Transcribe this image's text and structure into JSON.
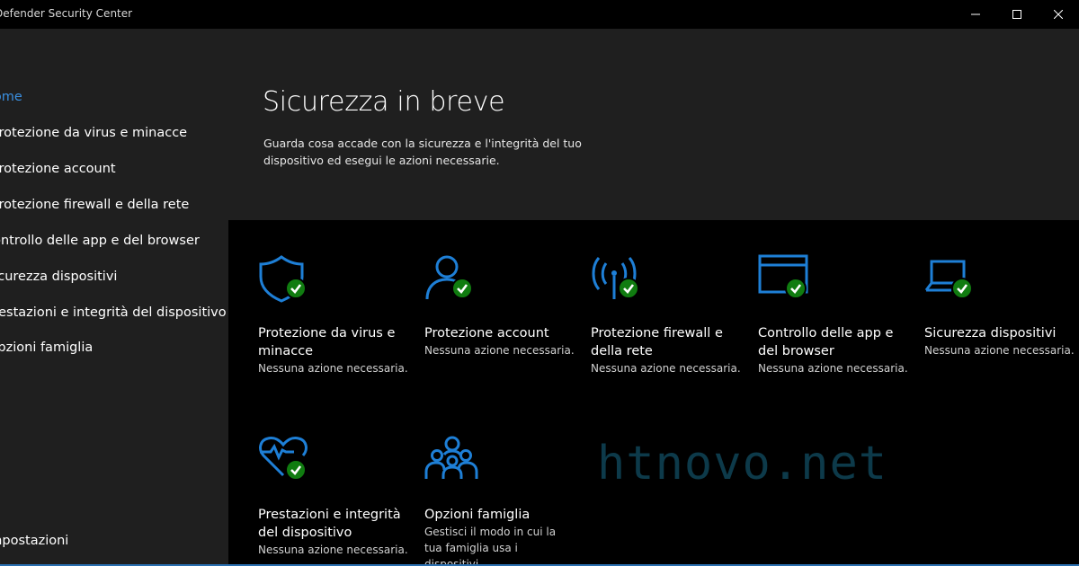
{
  "window": {
    "title": "Defender Security Center",
    "controls": [
      "minimize-icon",
      "maximize-icon",
      "close-icon"
    ]
  },
  "sidebar": {
    "items": [
      {
        "label": "Home",
        "active": true
      },
      {
        "label": "Protezione da virus e minacce"
      },
      {
        "label": "Protezione account"
      },
      {
        "label": "Protezione firewall e della rete"
      },
      {
        "label": "Controllo delle app e del browser"
      },
      {
        "label": "Sicurezza dispositivi"
      },
      {
        "label": "Prestazioni e integrità del dispositivo"
      },
      {
        "label": "Opzioni famiglia"
      }
    ],
    "settings_label": "Impostazioni"
  },
  "header": {
    "title": "Sicurezza in breve",
    "subtitle": "Guarda cosa accade con la sicurezza e l'integrità del tuo dispositivo ed esegui le azioni necessarie."
  },
  "tiles": [
    {
      "icon": "shield-icon",
      "title": "Protezione da virus e minacce",
      "status": "Nessuna azione necessaria."
    },
    {
      "icon": "person-icon",
      "title": "Protezione account",
      "status": "Nessuna azione necessaria."
    },
    {
      "icon": "wifi-antenna-icon",
      "title": "Protezione firewall e della rete",
      "status": "Nessuna azione necessaria."
    },
    {
      "icon": "browser-window-icon",
      "title": "Controllo delle app e del browser",
      "status": "Nessuna azione necessaria."
    },
    {
      "icon": "laptop-icon",
      "title": "Sicurezza dispositivi",
      "status": "Nessuna azione necessaria."
    },
    {
      "icon": "heart-pulse-icon",
      "title": "Prestazioni e integrità del dispositivo",
      "status": "Nessuna azione necessaria."
    },
    {
      "icon": "family-icon",
      "title": "Opzioni famiglia",
      "status": "Gestisci il modo in cui la tua famiglia usa i dispositivi."
    }
  ],
  "watermark": "htnovo.net",
  "colors": {
    "accent": "#3a8fe0",
    "icon_blue": "#1e7fd6",
    "check_green": "#107c10",
    "sidebar_bg": "#1f1f1f",
    "content_bg": "#000000"
  }
}
